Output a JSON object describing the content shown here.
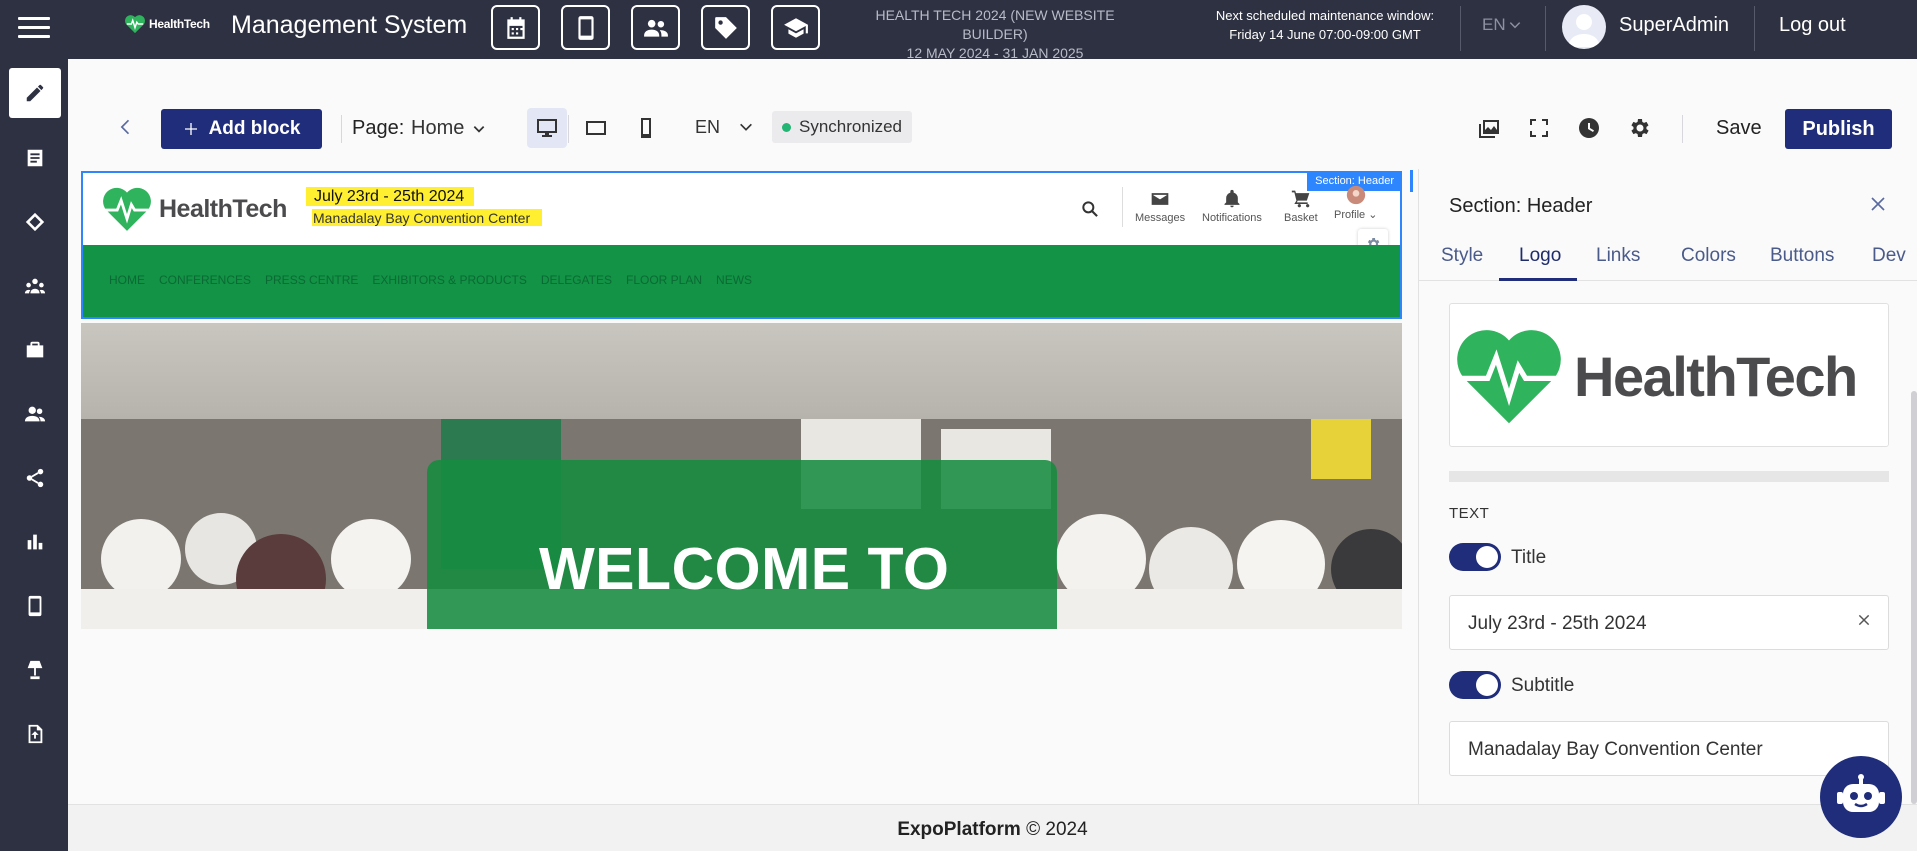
{
  "app": {
    "brand_name": "HealthTech",
    "title": "Management System",
    "event_name": "HEALTH TECH 2024 (NEW WEBSITE BUILDER)",
    "event_dates": "12 MAY 2024 - 31 JAN 2025",
    "maintenance_title": "Next scheduled maintenance window:",
    "maintenance_time": "Friday 14 June 07:00-09:00 GMT",
    "language": "EN",
    "user_name": "SuperAdmin",
    "logout_label": "Log out",
    "top_icons": [
      "calendar-icon",
      "mobile-icon",
      "people-icon",
      "tag-icon",
      "graduation-cap-icon"
    ]
  },
  "sidebar": {
    "items": [
      "edit-icon",
      "list-icon",
      "tag-icon",
      "network-icon",
      "briefcase-icon",
      "users-icon",
      "share-icon",
      "bar-chart-icon",
      "mobile-icon",
      "lamp-icon",
      "file-upload-icon"
    ],
    "active_index": 0
  },
  "toolbar": {
    "add_block_label": "Add block",
    "page_label": "Page:",
    "page_value": "Home",
    "language": "EN",
    "sync_status": "Synchronized",
    "save_label": "Save",
    "publish_label": "Publish"
  },
  "preview": {
    "section_tag": "Section: Header",
    "logo_text": "HealthTech",
    "title": "July 23rd - 25th 2024",
    "subtitle": "Manadalay Bay Convention Center",
    "nav_icons": [
      {
        "label": "Messages"
      },
      {
        "label": "Notifications"
      },
      {
        "label": "Basket"
      },
      {
        "label": "Profile ⌄"
      }
    ],
    "nav_links": [
      "HOME",
      "CONFERENCES",
      "PRESS CENTRE",
      "EXHIBITORS & PRODUCTS",
      "DELEGATES",
      "FLOOR PLAN",
      "NEWS"
    ],
    "hero_text": "WELCOME TO",
    "accent_color": "#129346",
    "highlight_color": "#ffef30"
  },
  "panel": {
    "title": "Section: Header",
    "tabs": [
      "Style",
      "Logo",
      "Links",
      "Colors",
      "Buttons",
      "Dev"
    ],
    "active_tab": "Logo",
    "logo_text": "HealthTech",
    "text_section_label": "TEXT",
    "title_toggle_label": "Title",
    "title_value": "July 23rd - 25th 2024",
    "subtitle_toggle_label": "Subtitle",
    "subtitle_value": "Manadalay Bay Convention Center"
  },
  "footer": {
    "brand": "ExpoPlatform",
    "copyright": "© 2024"
  },
  "colors": {
    "topbar_bg": "#2e3141",
    "primary": "#1f2d7b",
    "selection_blue": "#2e86ff",
    "sync_green": "#22b573"
  }
}
